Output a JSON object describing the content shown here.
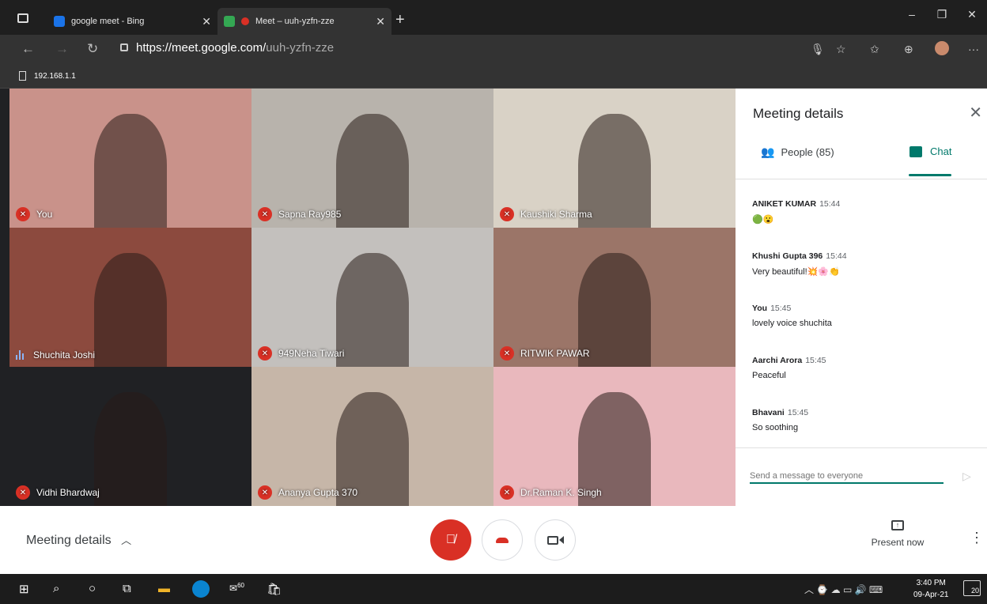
{
  "browser": {
    "tabs": [
      {
        "title": "google meet - Bing"
      },
      {
        "title": "Meet – uuh-yzfn-zze"
      }
    ],
    "url_host": "https://meet.google.com/",
    "url_path": "uuh-yzfn-zze",
    "favorite": "192.168.1.1"
  },
  "participants": [
    {
      "name": "You",
      "muted": true,
      "bg": "#c9928a"
    },
    {
      "name": "Sapna Ray985",
      "muted": true,
      "bg": "#b8b3ac"
    },
    {
      "name": "Kaushiki Sharma",
      "muted": true,
      "bg": "#d9d2c6"
    },
    {
      "name": "Shuchita Joshi",
      "muted": false,
      "bg": "#8c4a3e"
    },
    {
      "name": "949Neha Tiwari",
      "muted": true,
      "bg": "#c3c0bd"
    },
    {
      "name": "RITWIK PAWAR",
      "muted": true,
      "bg": "#9b7568"
    },
    {
      "name": "Vidhi Bhardwaj",
      "muted": true,
      "bg": "#202124"
    },
    {
      "name": "Ananya Gupta 370",
      "muted": true,
      "bg": "#c6b6a8"
    },
    {
      "name": "Dr.Raman K. Singh",
      "muted": true,
      "bg": "#e9b8bd"
    }
  ],
  "panel": {
    "title": "Meeting details",
    "people_tab": "People (85)",
    "chat_tab": "Chat",
    "messages": [
      {
        "sender": "ANIKET KUMAR",
        "time": "15:44",
        "text": "🟢😮"
      },
      {
        "sender": "Khushi Gupta 396",
        "time": "15:44",
        "text": "Very beautiful!💥🌸👏"
      },
      {
        "sender": "You",
        "time": "15:45",
        "text": "lovely voice shuchita"
      },
      {
        "sender": "Aarchi Arora",
        "time": "15:45",
        "text": "Peaceful"
      },
      {
        "sender": "Bhavani",
        "time": "15:45",
        "text": "So soothing"
      }
    ],
    "input_placeholder": "Send a message to everyone"
  },
  "bottom": {
    "details_label": "Meeting details",
    "present_label": "Present now"
  },
  "taskbar": {
    "time": "3:40 PM",
    "date": "09-Apr-21",
    "store_badge": "60",
    "notif_count": "20"
  },
  "colors": {
    "accent": "#00796b",
    "danger": "#d93025"
  }
}
